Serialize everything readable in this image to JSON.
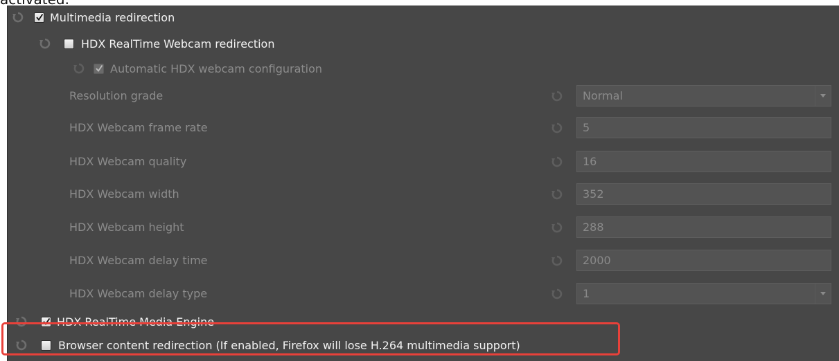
{
  "header_fragment": "activated.",
  "items": {
    "multimedia_redirection": {
      "label": "Multimedia redirection",
      "checked": true
    },
    "hdx_webcam_redirection": {
      "label": "HDX RealTime Webcam redirection",
      "checked": false
    },
    "auto_webcam_config": {
      "label": "Automatic HDX webcam configuration",
      "checked": true,
      "disabled": true
    },
    "hdx_media_engine": {
      "label": "HDX RealTime Media Engine",
      "checked": true
    },
    "browser_content_redirection": {
      "label": "Browser content redirection (If enabled, Firefox will lose H.264 multimedia support)",
      "checked": false
    }
  },
  "settings": {
    "resolution_grade": {
      "label": "Resolution grade",
      "value": "Normal",
      "type": "select"
    },
    "frame_rate": {
      "label": "HDX Webcam frame rate",
      "value": "5",
      "type": "text"
    },
    "quality": {
      "label": "HDX Webcam quality",
      "value": "16",
      "type": "text"
    },
    "width": {
      "label": "HDX Webcam width",
      "value": "352",
      "type": "text"
    },
    "height": {
      "label": "HDX Webcam height",
      "value": "288",
      "type": "text"
    },
    "delay_time": {
      "label": "HDX Webcam delay time",
      "value": "2000",
      "type": "text"
    },
    "delay_type": {
      "label": "HDX Webcam delay type",
      "value": "1",
      "type": "select"
    }
  },
  "colors": {
    "panel_bg": "#474747",
    "highlight": "#e8413a",
    "enabled_text": "#f2f2f2",
    "disabled_text": "#8c8c8c"
  },
  "icons": {
    "reset": "reset-to-default-icon",
    "checkmark": "checkmark-icon",
    "dropdown": "chevron-down-icon"
  }
}
